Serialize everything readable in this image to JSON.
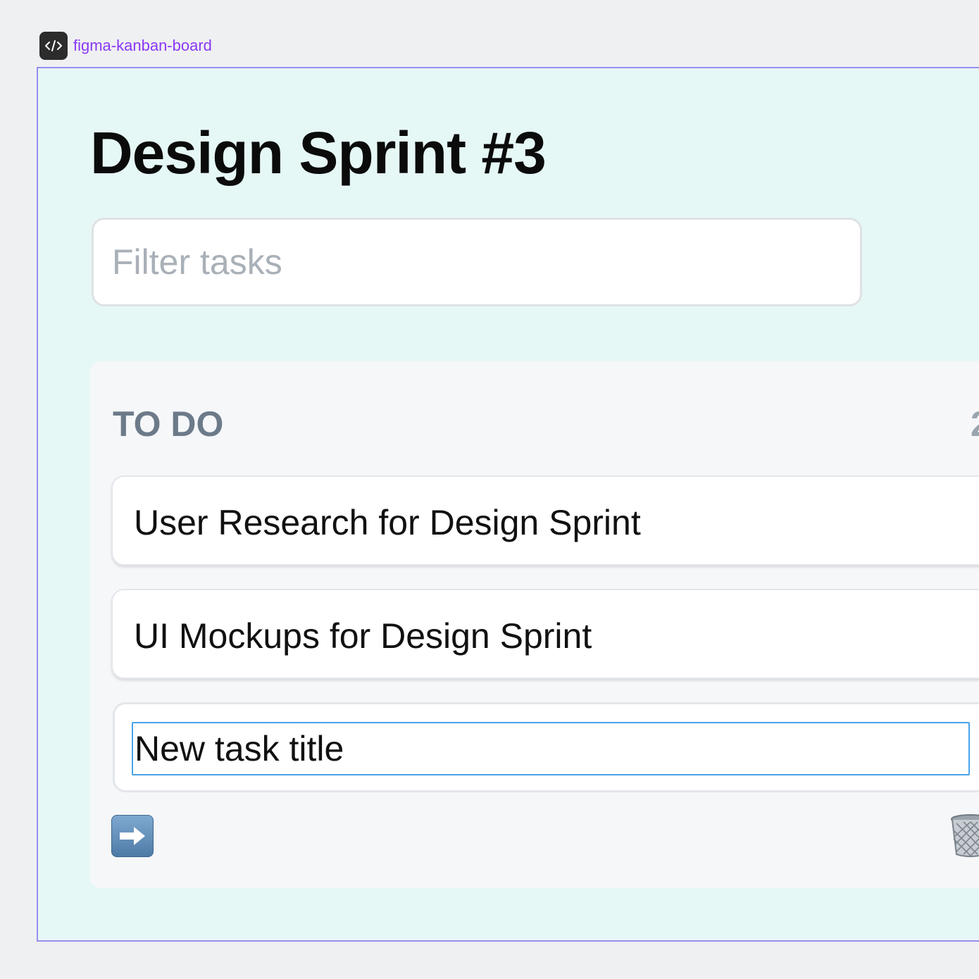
{
  "figma": {
    "frame_name": "figma-kanban-board"
  },
  "board": {
    "title": "Design Sprint #3",
    "filter_placeholder": "Filter tasks"
  },
  "column": {
    "title": "TO DO",
    "count": "2",
    "cards": [
      {
        "title": "User Research for Design Sprint"
      },
      {
        "title": "UI Mockups for Design Sprint"
      }
    ],
    "new_task_value": "New task title"
  },
  "icons": {
    "frame_badge": "code-icon",
    "submit": "right-arrow-icon",
    "delete": "wastebasket-icon"
  },
  "colors": {
    "frame_label": "#8a38f5",
    "frame_background": "#e6f8f6",
    "column_background": "#f6f7f9",
    "input_focus": "#4aa3e8"
  }
}
